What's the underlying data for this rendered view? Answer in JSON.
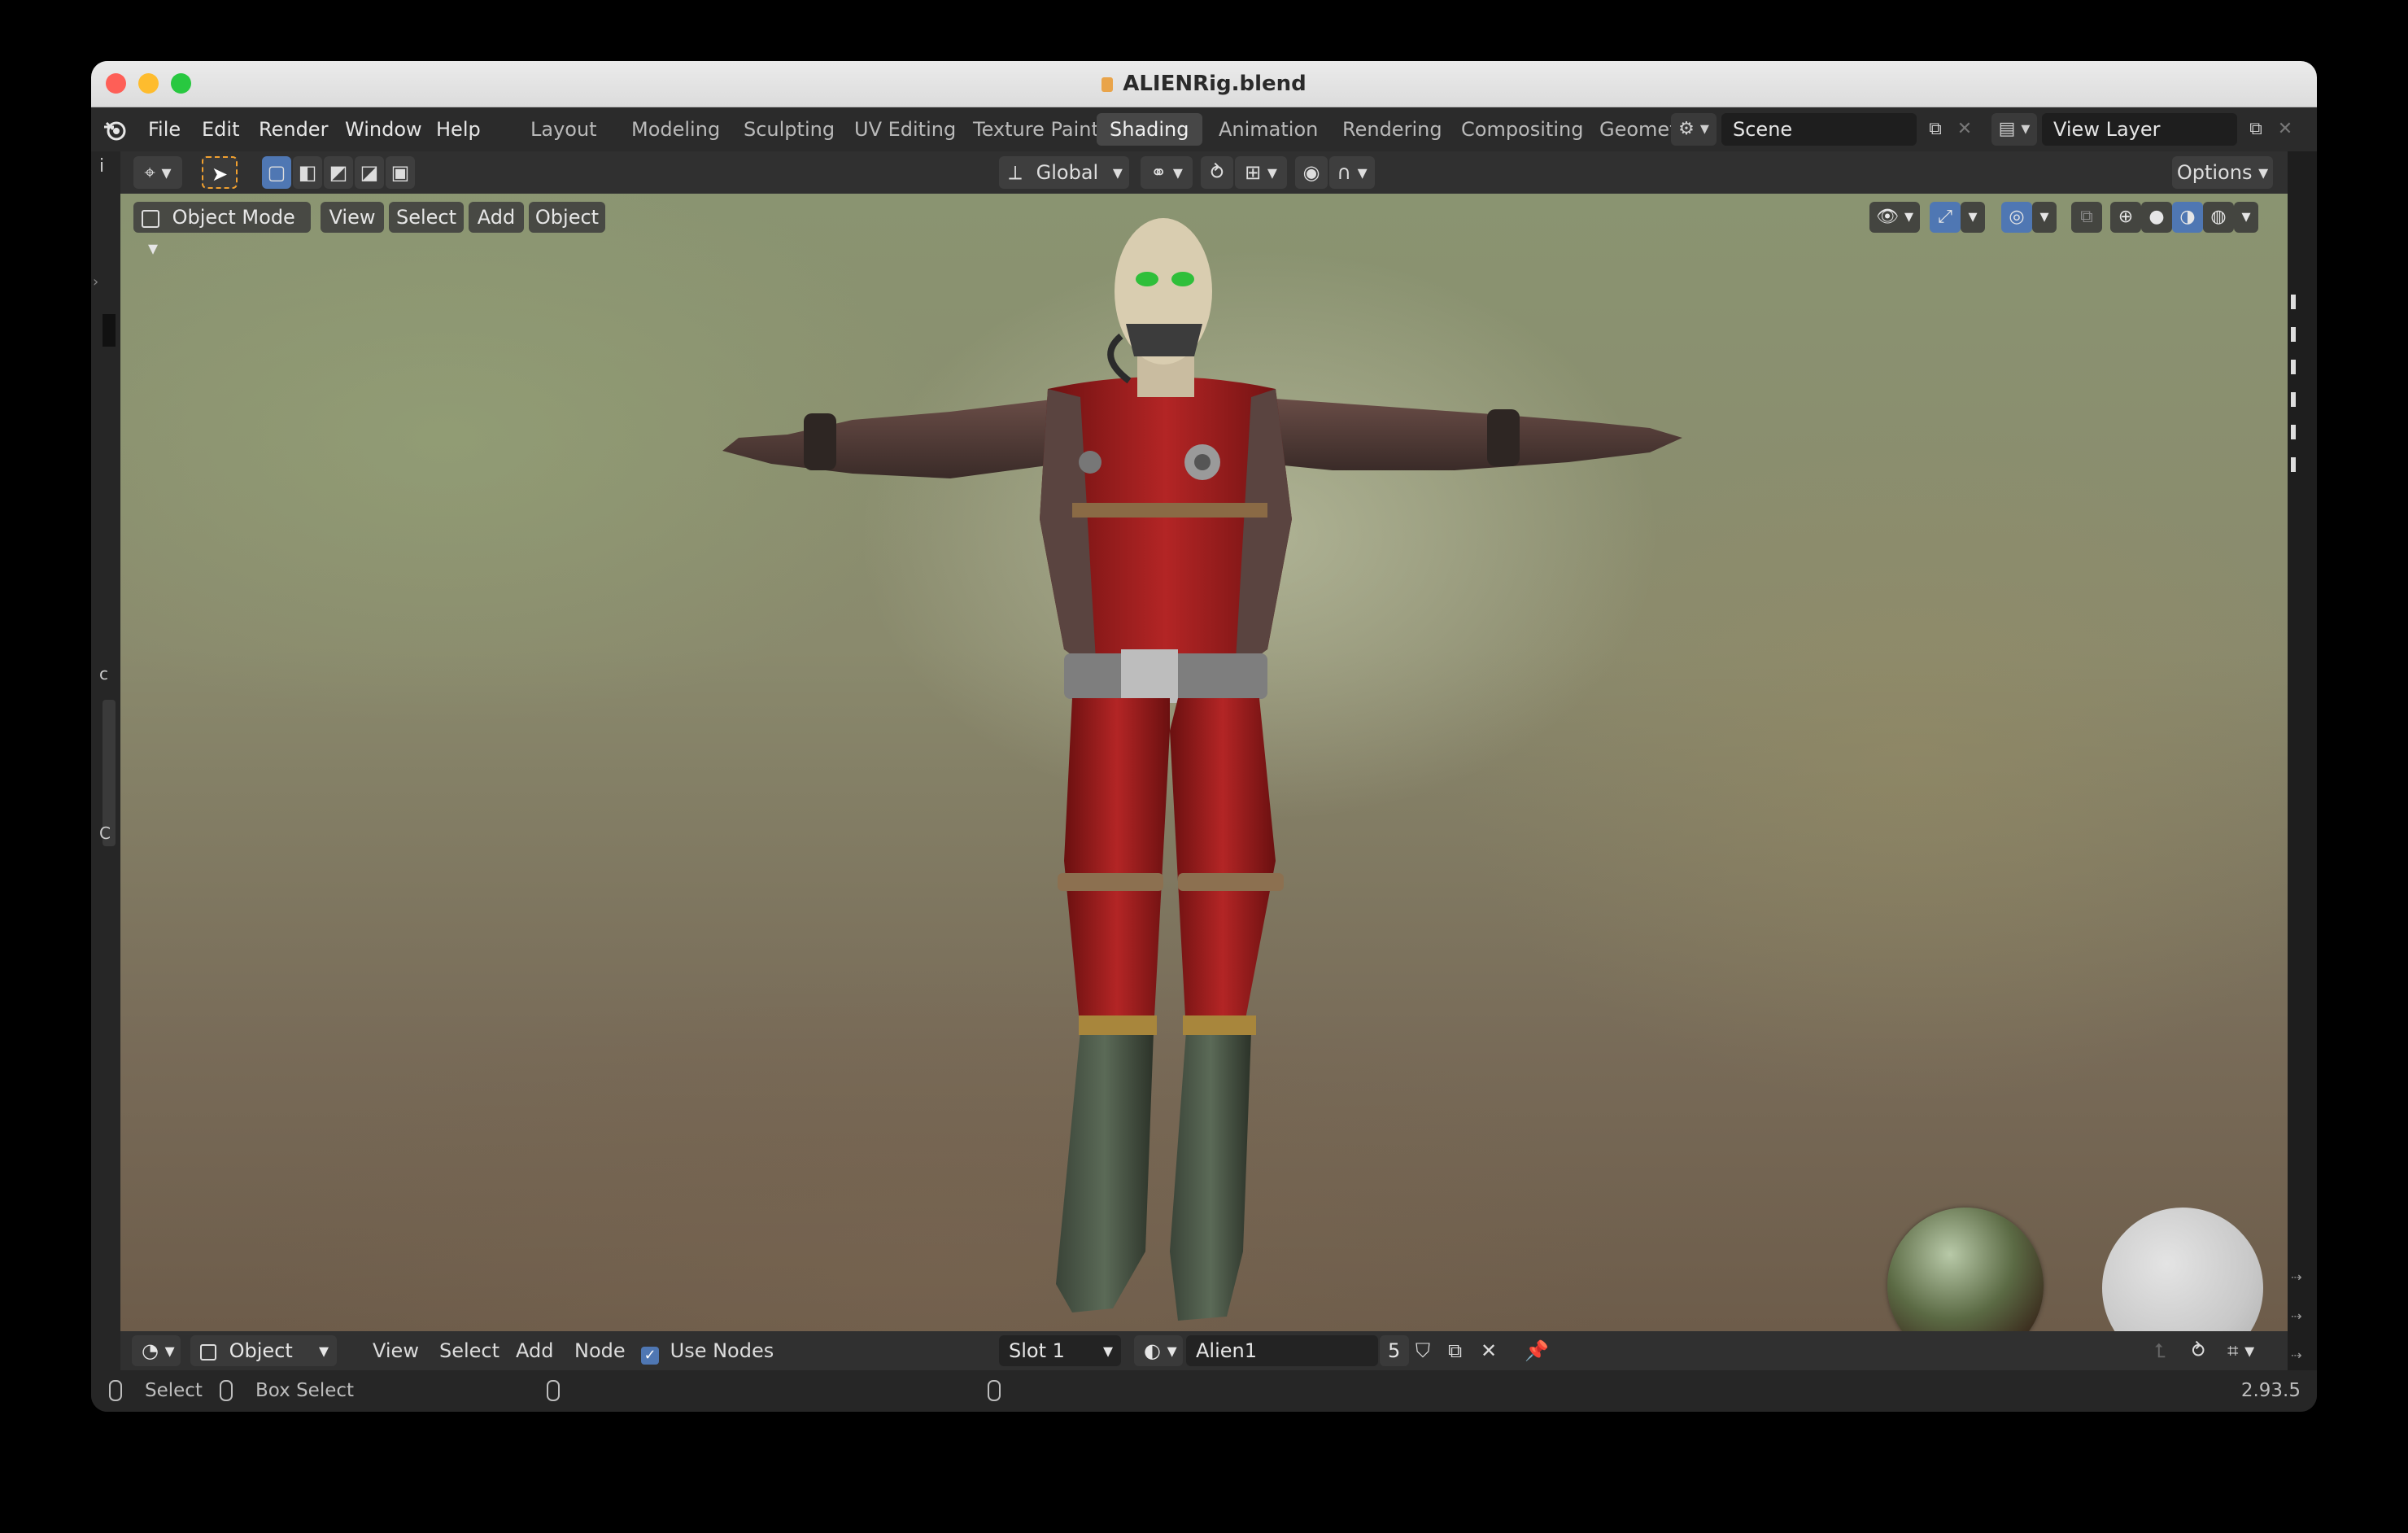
{
  "window": {
    "title": "ALIENRig.blend",
    "traffic_colors": {
      "close": "#fe5f57",
      "minimize": "#febc2e",
      "zoom": "#28c840"
    }
  },
  "menu": {
    "items": [
      "File",
      "Edit",
      "Render",
      "Window",
      "Help"
    ]
  },
  "workspaces": {
    "tabs": [
      "Layout",
      "Modeling",
      "Sculpting",
      "UV Editing",
      "Texture Paint",
      "Shading",
      "Animation",
      "Rendering",
      "Compositing",
      "Geomet"
    ],
    "active": "Shading"
  },
  "scene": {
    "name": "Scene"
  },
  "view_layer": {
    "name": "View Layer"
  },
  "toolbar": {
    "transform_orientation": "Global",
    "options_label": "Options"
  },
  "viewport": {
    "mode": "Object Mode",
    "menus": [
      "View",
      "Select",
      "Add",
      "Object"
    ],
    "shading_active": "material-preview"
  },
  "node_editor": {
    "object_type": "Object",
    "menus": [
      "View",
      "Select",
      "Add",
      "Node"
    ],
    "use_nodes_label": "Use Nodes",
    "use_nodes_checked": true,
    "slot": "Slot 1",
    "material_name": "Alien1",
    "user_count": "5"
  },
  "statusbar": {
    "select_label": "Select",
    "box_select_label": "Box Select",
    "version": "2.93.5"
  },
  "colors": {
    "accent_blue": "#4f77b3",
    "active_tab_bg": "#474747",
    "suit_red": "#9e1f1f",
    "skin": "#d9cdb0"
  }
}
